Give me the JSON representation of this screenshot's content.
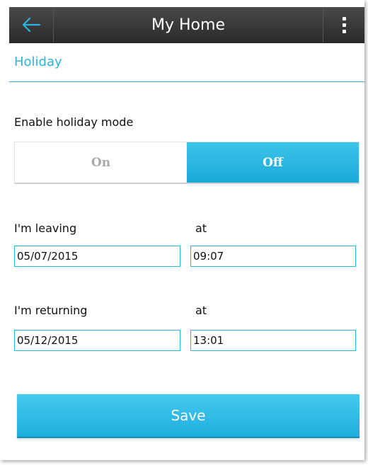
{
  "header": {
    "title": "My Home",
    "back_icon": "arrow-left-icon",
    "menu_icon": "more-vertical-icon"
  },
  "section": {
    "title": "Holiday"
  },
  "holiday_mode": {
    "label": "Enable holiday mode",
    "on_label": "On",
    "off_label": "Off",
    "selected": "Off"
  },
  "leaving": {
    "label": "I'm leaving",
    "at_label": "at",
    "date": "05/07/2015",
    "time": "09:07"
  },
  "returning": {
    "label": "I'm returning",
    "at_label": "at",
    "date": "05/12/2015",
    "time": "13:01"
  },
  "actions": {
    "save_label": "Save"
  },
  "colors": {
    "accent": "#29b5df",
    "topbar": "#3a3a3a",
    "toggle_active": "#1daedc"
  }
}
